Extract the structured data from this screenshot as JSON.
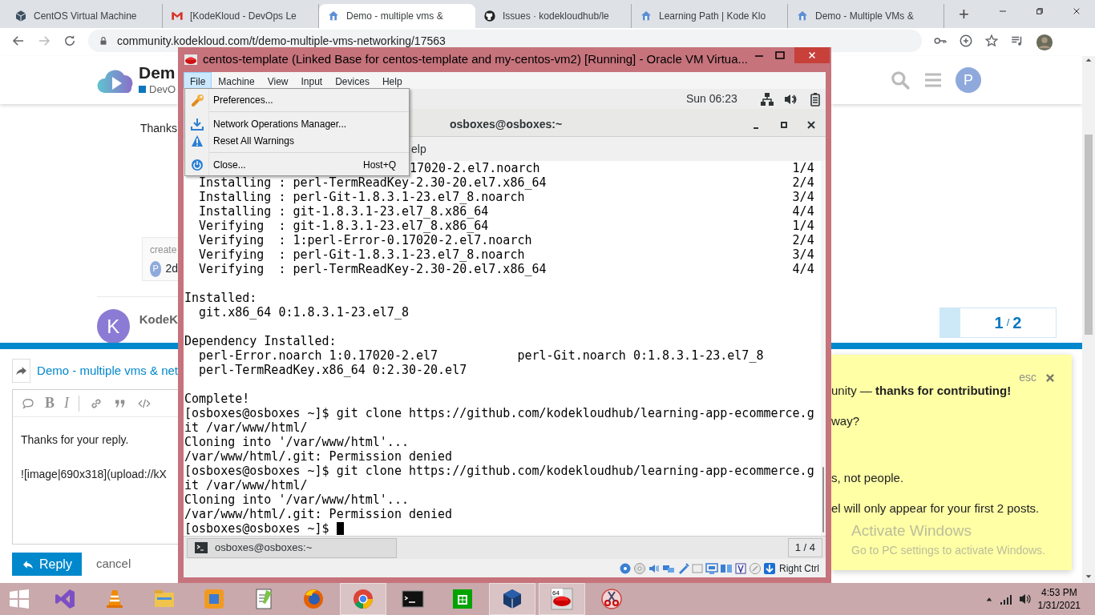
{
  "browser": {
    "tabs": [
      {
        "kind": "cube",
        "title": "CentOS Virtual Machine",
        "selected": false
      },
      {
        "kind": "mail",
        "title": "[KodeKloud - DevOps Le",
        "selected": false
      },
      {
        "kind": "site",
        "title": "Demo - multiple vms & ",
        "selected": true
      },
      {
        "kind": "github",
        "title": "Issues · kodekloudhub/le",
        "selected": false
      },
      {
        "kind": "site",
        "title": "Learning Path | Kode Klo",
        "selected": false
      },
      {
        "kind": "site",
        "title": "Demo - Multiple VMs &",
        "selected": false
      }
    ],
    "new_tab": "+",
    "url": "community.kodekloud.com/t/demo-multiple-vms-networking/17563"
  },
  "page": {
    "header": {
      "title": "Dem",
      "category": "DevO",
      "avatar": "P"
    },
    "post": {
      "text": "Thanks",
      "created_label": "create",
      "created_avatar": "P",
      "created_time": "2d"
    },
    "next_post": {
      "avatar": "K",
      "author": "KodeK"
    },
    "timeline": {
      "current": "1",
      "separator": "/",
      "total": "2"
    },
    "composer": {
      "reply_to": "Demo - multiple vms & net",
      "toolbar": [
        {
          "kind": "bubble"
        },
        {
          "kind": "bold",
          "label": "B"
        },
        {
          "kind": "italic",
          "label": "I"
        },
        {
          "kind": "divider"
        },
        {
          "kind": "link"
        },
        {
          "kind": "quote"
        },
        {
          "kind": "code"
        }
      ],
      "lines": [
        "Thanks for your reply.",
        "![image|690x318](upload://kX"
      ],
      "submit": "Reply",
      "cancel": "cancel"
    },
    "education_panel": {
      "dismiss": "esc",
      "lines": [
        "unity — **thanks for contributing!**",
        "way?",
        "s, not people.",
        "el will only appear for your first 2 posts."
      ]
    }
  },
  "activation_notice": {
    "title": "Activate Windows",
    "subtitle": "Go to PC settings to activate Windows."
  },
  "vm_window": {
    "title": "centos-template (Linked Base for centos-template and my-centos-vm2) [Running] - Oracle VM Virtua...",
    "menu": [
      {
        "label": "File",
        "selected": true
      },
      {
        "label": "Machine",
        "selected": false
      },
      {
        "label": "View",
        "selected": false
      },
      {
        "label": "Input",
        "selected": false
      },
      {
        "label": "Devices",
        "selected": false
      },
      {
        "label": "Help",
        "selected": false
      }
    ],
    "file_menu": [
      {
        "kind": "preferences",
        "label": "Preferences..."
      },
      {
        "kind": "separator"
      },
      {
        "kind": "network-manager",
        "label": "Network Operations Manager..."
      },
      {
        "kind": "reset-warnings",
        "label": "Reset All Warnings"
      },
      {
        "kind": "separator"
      },
      {
        "kind": "close",
        "label": "Close...",
        "shortcut": "Host+Q"
      }
    ],
    "guest": {
      "clock": "Sun 06:23",
      "terminal": {
        "title": "osboxes@osboxes:~",
        "menu_fragment": "elp",
        "lines": [
          {
            "kind": "partial",
            "text": "17020-2.el7.noarch",
            "count": "1/4"
          },
          {
            "kind": "text",
            "text": "  Installing : perl-TermReadKey-2.30-20.el7.x86_64",
            "count": "2/4"
          },
          {
            "kind": "text",
            "text": "  Installing : perl-Git-1.8.3.1-23.el7_8.noarch",
            "count": "3/4"
          },
          {
            "kind": "text",
            "text": "  Installing : git-1.8.3.1-23.el7_8.x86_64",
            "count": "4/4"
          },
          {
            "kind": "text",
            "text": "  Verifying  : git-1.8.3.1-23.el7_8.x86_64",
            "count": "1/4"
          },
          {
            "kind": "text",
            "text": "  Verifying  : 1:perl-Error-0.17020-2.el7.noarch",
            "count": "2/4"
          },
          {
            "kind": "text",
            "text": "  Verifying  : perl-Git-1.8.3.1-23.el7_8.noarch",
            "count": "3/4"
          },
          {
            "kind": "text",
            "text": "  Verifying  : perl-TermReadKey-2.30-20.el7.x86_64",
            "count": "4/4"
          },
          {
            "kind": "blank"
          },
          {
            "kind": "text",
            "text": "Installed:"
          },
          {
            "kind": "text",
            "text": "  git.x86_64 0:1.8.3.1-23.el7_8"
          },
          {
            "kind": "blank"
          },
          {
            "kind": "text",
            "text": "Dependency Installed:"
          },
          {
            "kind": "text",
            "text": "  perl-Error.noarch 1:0.17020-2.el7           perl-Git.noarch 0:1.8.3.1-23.el7_8"
          },
          {
            "kind": "text",
            "text": "  perl-TermReadKey.x86_64 0:2.30-20.el7"
          },
          {
            "kind": "blank"
          },
          {
            "kind": "text",
            "text": "Complete!"
          },
          {
            "kind": "text",
            "text": "[osboxes@osboxes ~]$ git clone https://github.com/kodekloudhub/learning-app-ecommerce.g"
          },
          {
            "kind": "text",
            "text": "it /var/www/html/"
          },
          {
            "kind": "text",
            "text": "Cloning into '/var/www/html'..."
          },
          {
            "kind": "text",
            "text": "/var/www/html/.git: Permission denied"
          },
          {
            "kind": "text",
            "text": "[osboxes@osboxes ~]$ git clone https://github.com/kodekloudhub/learning-app-ecommerce.g"
          },
          {
            "kind": "text",
            "text": "it /var/www/html/"
          },
          {
            "kind": "text",
            "text": "Cloning into '/var/www/html'..."
          },
          {
            "kind": "text",
            "text": "/var/www/html/.git: Permission denied"
          },
          {
            "kind": "prompt",
            "text": "[osboxes@osboxes ~]$ "
          }
        ]
      },
      "window_list": {
        "item": "osboxes@osboxes:~",
        "workspace": "1 / 4"
      }
    },
    "status_bar": {
      "host_key": "Right Ctrl"
    }
  },
  "taskbar": {
    "items": [
      {
        "kind": "start",
        "active": false
      },
      {
        "kind": "visual-studio",
        "active": false
      },
      {
        "kind": "vlc",
        "active": false
      },
      {
        "kind": "explorer",
        "active": false
      },
      {
        "kind": "orange-app",
        "active": false
      },
      {
        "kind": "notepad",
        "active": false
      },
      {
        "kind": "firefox",
        "active": false
      },
      {
        "kind": "chrome",
        "active": true
      },
      {
        "kind": "cmd",
        "active": false
      },
      {
        "kind": "store",
        "active": false
      },
      {
        "kind": "virtualbox",
        "active": true
      },
      {
        "kind": "red-hat",
        "active": true,
        "badge": "64"
      },
      {
        "kind": "snipping",
        "active": false
      }
    ],
    "time": "4:53 PM",
    "date": "1/31/2021"
  }
}
